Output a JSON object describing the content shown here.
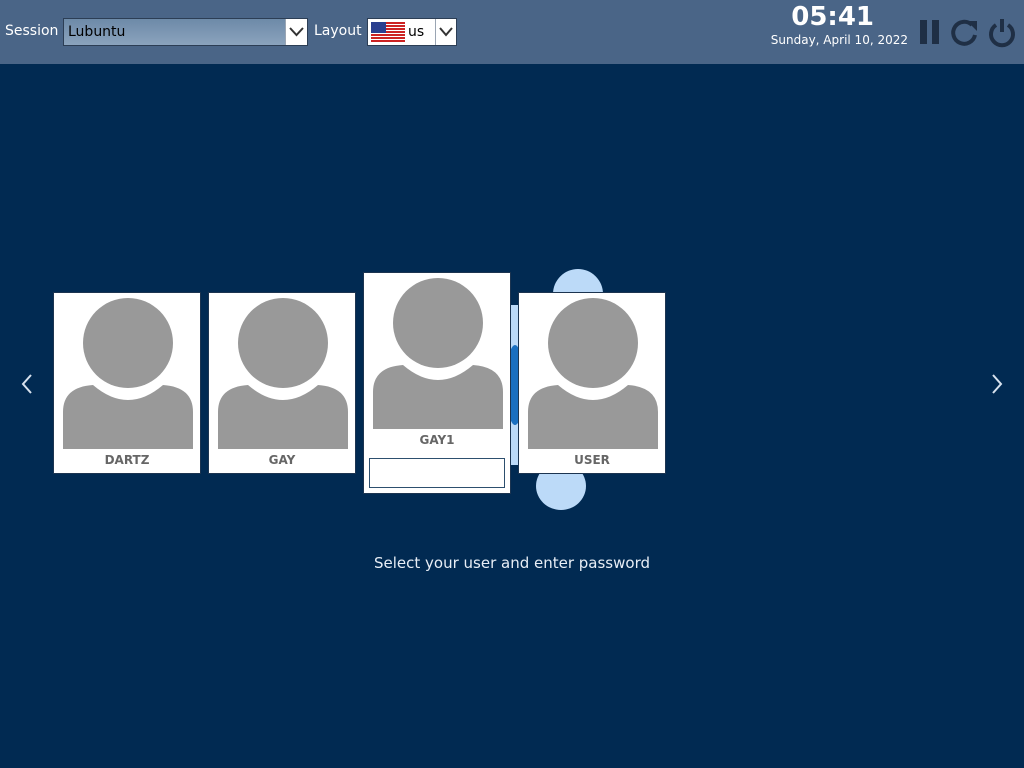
{
  "topbar": {
    "session_label": "Session",
    "session_value": "Lubuntu",
    "layout_label": "Layout",
    "layout_value": "us",
    "layout_flag": "us-flag-icon",
    "time": "05:41",
    "date": "Sunday, April 10, 2022",
    "actions": [
      "suspend-icon",
      "reboot-icon",
      "power-icon"
    ]
  },
  "users": [
    {
      "name": "DARTZ"
    },
    {
      "name": "GAY"
    },
    {
      "name": "GAY1",
      "selected": true,
      "password_value": ""
    },
    {
      "name": "USER"
    }
  ],
  "message": "Select your user and enter password",
  "colors": {
    "background": "#012a52",
    "topbar": "#4a6587",
    "avatar": "#999999",
    "accent": "#bcdaf8"
  }
}
